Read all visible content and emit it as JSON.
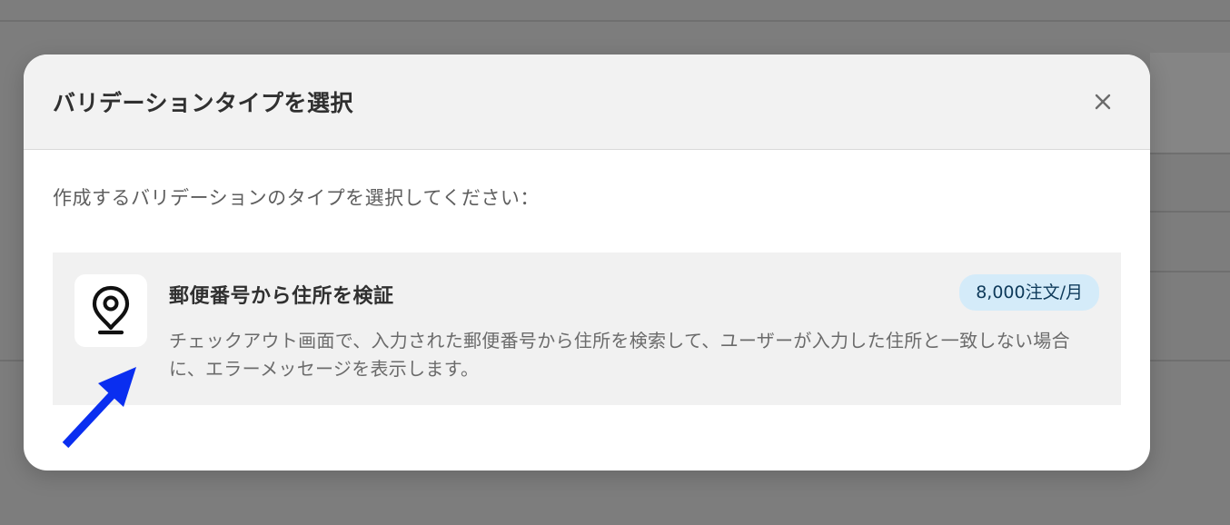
{
  "modal": {
    "title": "バリデーションタイプを選択",
    "close_label": "×",
    "description": "作成するバリデーションのタイプを選択してください：",
    "options": [
      {
        "icon": "map-pin-icon",
        "title": "郵便番号から住所を検証",
        "badge": "8,000注文/月",
        "description": "チェックアウト画面で、入力された郵便番号から住所を検索して、ユーザーが入力した住所と一致しない場合に、エラーメッセージを表示します。"
      }
    ]
  },
  "annotation": {
    "icon": "arrow-icon",
    "color": "#0a2ef0"
  },
  "colors": {
    "overlay": "#7d7d7d",
    "badge_bg": "#d4ebf9",
    "badge_text": "#0e3a5a"
  }
}
